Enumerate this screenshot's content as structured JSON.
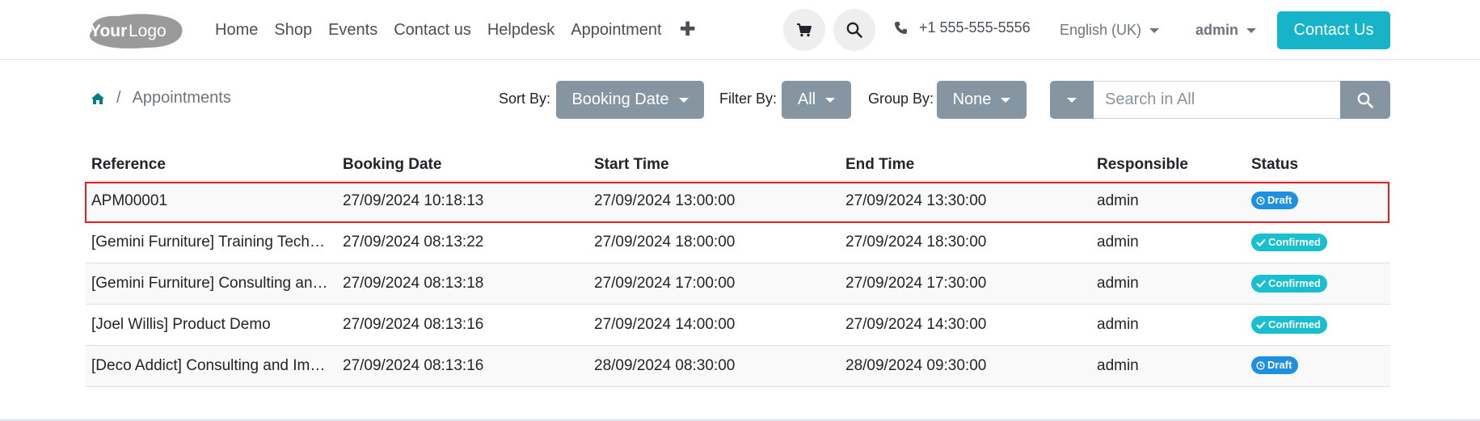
{
  "header": {
    "logo_text": "YourLogo",
    "nav": [
      "Home",
      "Shop",
      "Events",
      "Contact us",
      "Helpdesk",
      "Appointment"
    ],
    "plus_icon": "plus-icon",
    "cart_icon": "cart-icon",
    "search_icon": "search-icon",
    "phone": "+1 555-555-5556",
    "language": "English (UK)",
    "user": "admin",
    "contact_button": "Contact Us",
    "accent_color": "#17b4c9"
  },
  "breadcrumb": {
    "home_icon": "home-icon",
    "separator": "/",
    "current": "Appointments"
  },
  "toolbar": {
    "sort_label": "Sort By:",
    "sort_value": "Booking Date",
    "filter_label": "Filter By:",
    "filter_value": "All",
    "group_label": "Group By:",
    "group_value": "None",
    "search_placeholder": "Search in All"
  },
  "table": {
    "columns": [
      "Reference",
      "Booking Date",
      "Start Time",
      "End Time",
      "Responsible",
      "Status"
    ],
    "rows": [
      {
        "reference": "APM00001",
        "booking_date": "27/09/2024 10:18:13",
        "start_time": "27/09/2024 13:00:00",
        "end_time": "27/09/2024 13:30:00",
        "responsible": "admin",
        "status": "Draft"
      },
      {
        "reference": "[Gemini Furniture] Training Tech…",
        "booking_date": "27/09/2024 08:13:22",
        "start_time": "27/09/2024 18:00:00",
        "end_time": "27/09/2024 18:30:00",
        "responsible": "admin",
        "status": "Confirmed"
      },
      {
        "reference": "[Gemini Furniture] Consulting an…",
        "booking_date": "27/09/2024 08:13:18",
        "start_time": "27/09/2024 17:00:00",
        "end_time": "27/09/2024 17:30:00",
        "responsible": "admin",
        "status": "Confirmed"
      },
      {
        "reference": "[Joel Willis] Product Demo",
        "booking_date": "27/09/2024 08:13:16",
        "start_time": "27/09/2024 14:00:00",
        "end_time": "27/09/2024 14:30:00",
        "responsible": "admin",
        "status": "Confirmed"
      },
      {
        "reference": "[Deco Addict] Consulting and Im…",
        "booking_date": "27/09/2024 08:13:16",
        "start_time": "28/09/2024 08:30:00",
        "end_time": "28/09/2024 09:30:00",
        "responsible": "admin",
        "status": "Draft"
      }
    ]
  },
  "status_colors": {
    "Draft": "#1f8fe0",
    "Confirmed": "#19bfcf"
  },
  "highlight_color": "#e32020"
}
